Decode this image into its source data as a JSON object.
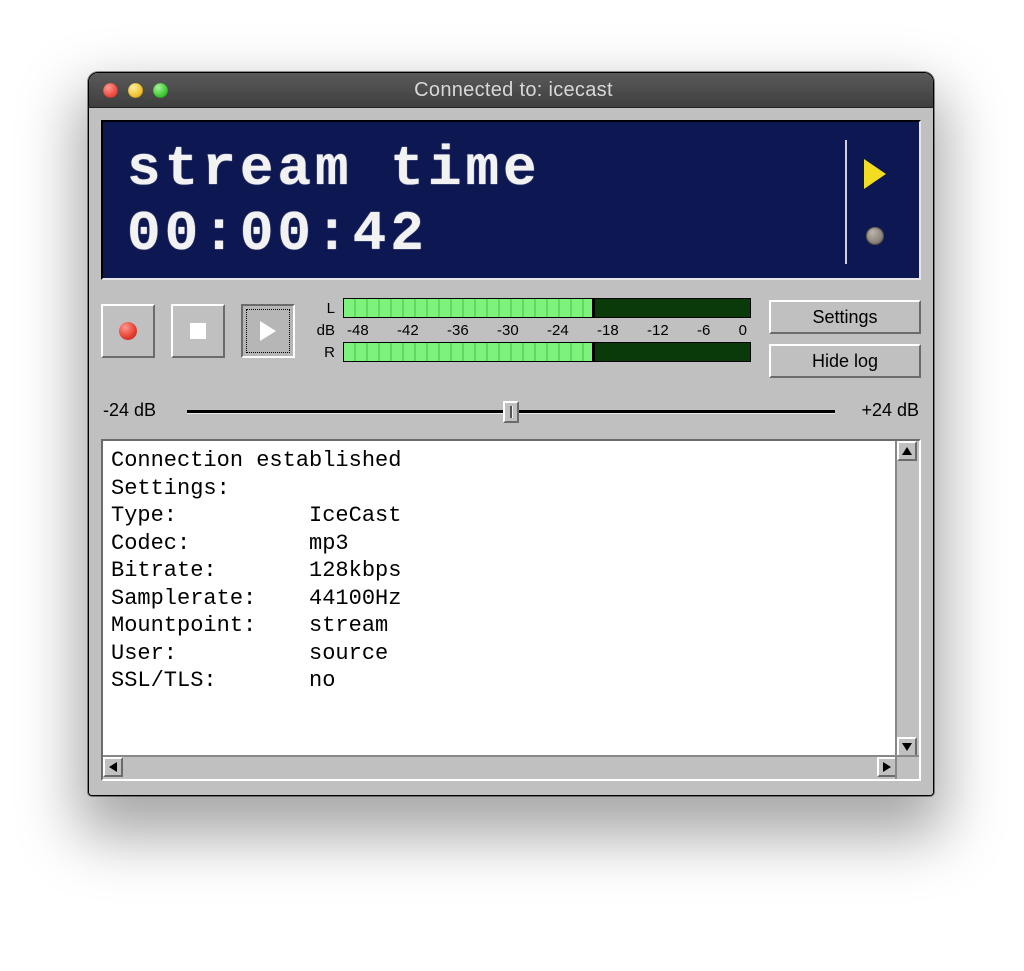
{
  "window": {
    "title": "Connected to: icecast"
  },
  "lcd": {
    "line1": "stream time",
    "line2": "00:00:42",
    "playing": true
  },
  "transport": {
    "record_icon": "record-icon",
    "stop_icon": "stop-icon",
    "play_icon": "play-icon"
  },
  "meter": {
    "left_label": "L",
    "right_label": "R",
    "db_label": "dB",
    "ticks": [
      "-48",
      "-42",
      "-36",
      "-30",
      "-24",
      "-18",
      "-12",
      "-6",
      "0"
    ],
    "level_percent": 61
  },
  "buttons": {
    "settings": "Settings",
    "hidelog": "Hide log"
  },
  "gain": {
    "min_label": "-24 dB",
    "max_label": "+24 dB",
    "value": 0
  },
  "log": {
    "lines": [
      "Connection established",
      "Settings:",
      "Type:          IceCast",
      "Codec:         mp3",
      "Bitrate:       128kbps",
      "Samplerate:    44100Hz",
      "Mountpoint:    stream",
      "User:          source",
      "SSL/TLS:       no"
    ],
    "settings": {
      "Type": "IceCast",
      "Codec": "mp3",
      "Bitrate": "128kbps",
      "Samplerate": "44100Hz",
      "Mountpoint": "stream",
      "User": "source",
      "SSL/TLS": "no"
    }
  }
}
